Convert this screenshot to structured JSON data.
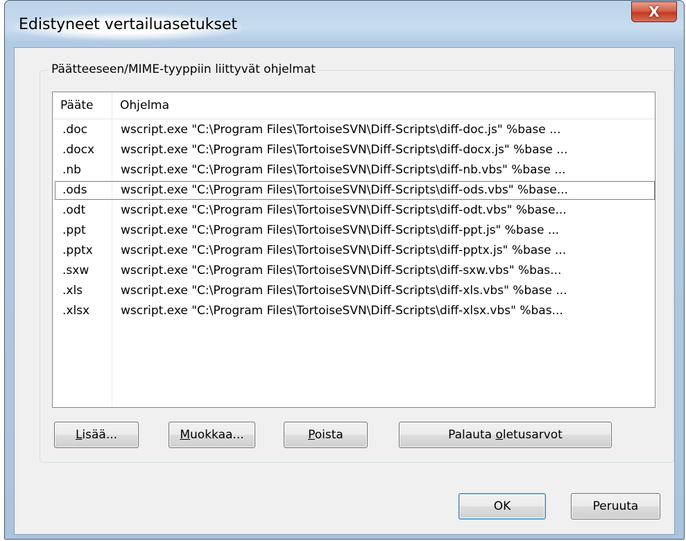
{
  "window": {
    "title": "Edistyneet vertailuasetukset",
    "close_glyph": "X"
  },
  "group": {
    "caption": "Päätteeseen/MIME-tyyppiin liittyvät ohjelmat"
  },
  "table": {
    "headers": [
      "Pääte",
      "Ohjelma"
    ],
    "rows": [
      {
        "ext": ".doc",
        "program": "wscript.exe \"C:\\Program Files\\TortoiseSVN\\Diff-Scripts\\diff-doc.js\" %base ..."
      },
      {
        "ext": ".docx",
        "program": "wscript.exe \"C:\\Program Files\\TortoiseSVN\\Diff-Scripts\\diff-docx.js\" %base ..."
      },
      {
        "ext": ".nb",
        "program": "wscript.exe \"C:\\Program Files\\TortoiseSVN\\Diff-Scripts\\diff-nb.vbs\" %base ..."
      },
      {
        "ext": ".ods",
        "program": "wscript.exe \"C:\\Program Files\\TortoiseSVN\\Diff-Scripts\\diff-ods.vbs\" %base..."
      },
      {
        "ext": ".odt",
        "program": "wscript.exe \"C:\\Program Files\\TortoiseSVN\\Diff-Scripts\\diff-odt.vbs\" %base..."
      },
      {
        "ext": ".ppt",
        "program": "wscript.exe \"C:\\Program Files\\TortoiseSVN\\Diff-Scripts\\diff-ppt.js\" %base ..."
      },
      {
        "ext": ".pptx",
        "program": "wscript.exe \"C:\\Program Files\\TortoiseSVN\\Diff-Scripts\\diff-pptx.js\" %base ..."
      },
      {
        "ext": ".sxw",
        "program": "wscript.exe \"C:\\Program Files\\TortoiseSVN\\Diff-Scripts\\diff-sxw.vbs\" %bas..."
      },
      {
        "ext": ".xls",
        "program": "wscript.exe \"C:\\Program Files\\TortoiseSVN\\Diff-Scripts\\diff-xls.vbs\" %base ..."
      },
      {
        "ext": ".xlsx",
        "program": "wscript.exe \"C:\\Program Files\\TortoiseSVN\\Diff-Scripts\\diff-xlsx.vbs\" %bas..."
      }
    ]
  },
  "buttons": {
    "add": {
      "mnemonic": "L",
      "rest": "isää..."
    },
    "edit": {
      "mnemonic": "M",
      "rest": "uokkaa..."
    },
    "remove": {
      "mnemonic": "P",
      "rest": "oista"
    },
    "restore": {
      "before": "Palauta ",
      "mnemonic": "o",
      "rest": "letusarvot"
    },
    "ok": "OK",
    "cancel": "Peruuta"
  }
}
